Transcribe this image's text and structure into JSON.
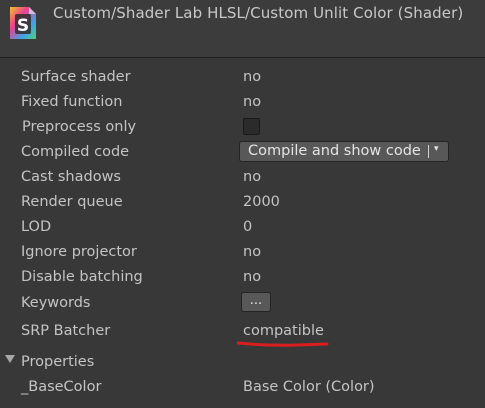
{
  "header": {
    "title": "Custom/Shader Lab HLSL/Custom Unlit Color (Shader)",
    "icon": "shader-file-icon",
    "icon_letter": "S"
  },
  "rows": [
    {
      "label": "Surface shader",
      "value": "no"
    },
    {
      "label": "Fixed function",
      "value": "no"
    },
    {
      "label": "Preprocess only",
      "checked": false
    },
    {
      "label": "Compiled code",
      "dropdown": "Compile and show code",
      "dropdown_icon": "▾"
    },
    {
      "label": "Cast shadows",
      "value": "no"
    },
    {
      "label": "Render queue",
      "value": "2000"
    },
    {
      "label": "LOD",
      "value": "0"
    },
    {
      "label": "Ignore projector",
      "value": "no"
    },
    {
      "label": "Disable batching",
      "value": "no"
    },
    {
      "label": "Keywords",
      "button": "..."
    },
    {
      "label": "SRP Batcher",
      "value": "compatible"
    }
  ],
  "properties": {
    "label": "Properties",
    "items": [
      {
        "name": "_BaseColor",
        "value": "Base Color (Color)"
      }
    ]
  },
  "colors": {
    "background": "#383838",
    "text": "#c4c4c4",
    "annotation_underline": "#d81e1e"
  }
}
